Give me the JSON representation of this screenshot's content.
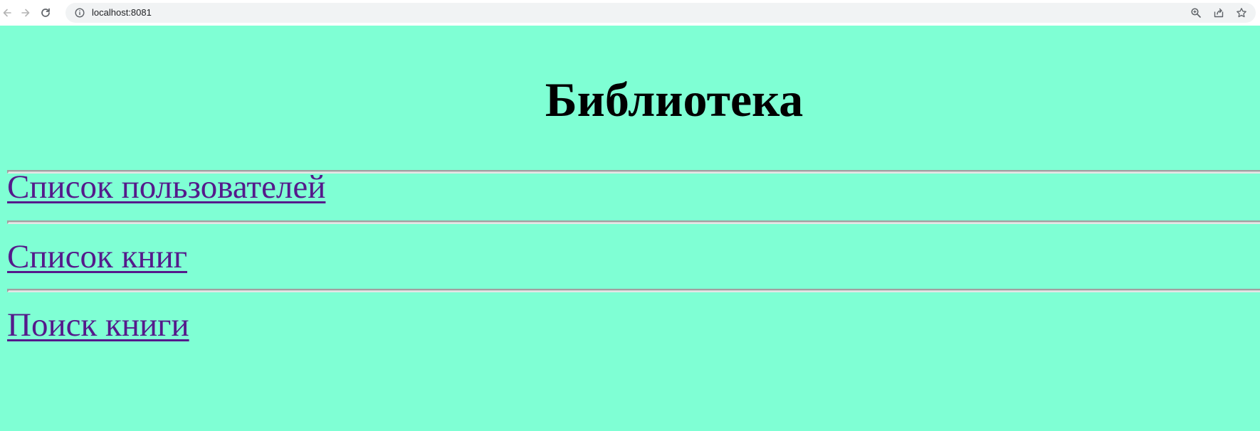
{
  "browser": {
    "url": "localhost:8081",
    "icons": {
      "back": "back-arrow-icon",
      "forward": "forward-arrow-icon",
      "reload": "reload-icon",
      "site_info": "info-icon",
      "zoom": "zoom-icon",
      "share": "share-icon",
      "bookmark": "star-icon"
    }
  },
  "page": {
    "background": "#7fffd4",
    "title": "Библиотека",
    "links": [
      {
        "label": "Список пользователей"
      },
      {
        "label": "Список книг"
      },
      {
        "label": "Поиск книги"
      }
    ],
    "link_color": "#551a8b"
  }
}
